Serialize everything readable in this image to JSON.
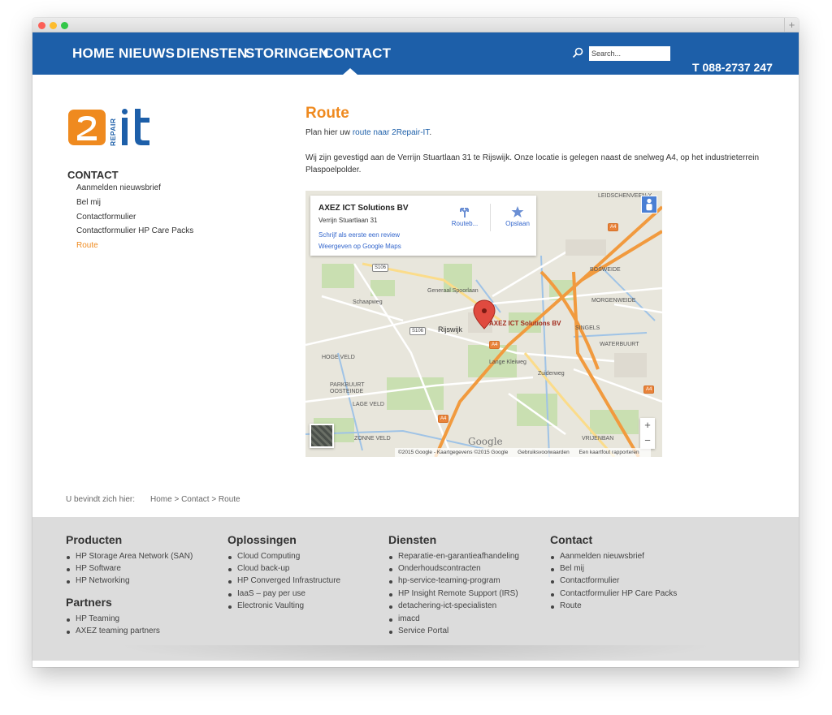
{
  "nav": {
    "items": [
      "HOME",
      "NIEUWS",
      "DIENSTEN",
      "STORINGEN",
      "CONTACT"
    ],
    "search_placeholder": "Search...",
    "phone": "T 088-2737 247"
  },
  "logo": {
    "text": "2REPAIR IT"
  },
  "sidebar": {
    "heading": "CONTACT",
    "items": [
      "Aanmelden nieuwsbrief",
      "Bel mij",
      "Contactformulier",
      "Contactformulier HP Care Packs",
      "Route"
    ],
    "active": "Route"
  },
  "content": {
    "title": "Route",
    "intro_prefix": "Plan hier uw ",
    "intro_link": "route naar 2Repair-IT",
    "intro_suffix": ".",
    "body": "Wij zijn gevestigd aan de Verrijn Stuartlaan 31 te Rijswijk. Onze locatie is gelegen naast de snelweg A4, op het industrieterrein Plaspoelpolder."
  },
  "map": {
    "place_name": "AXEZ ICT Solutions BV",
    "address": "Verrijn Stuartlaan 31",
    "link_review": "Schrijf als eerste een review",
    "link_maps": "Weergeven op Google Maps",
    "btn_route": "Routeb...",
    "btn_save": "Opslaan",
    "pin_label": "AXEZ ICT Solutions BV",
    "zoom_in": "+",
    "zoom_out": "−",
    "google": "Google",
    "attribution": [
      "©2015 Google - Kaartgegevens ©2015 Google",
      "Gebruiksvoorwaarden",
      "Een kaartfout rapporteren"
    ],
    "labels": [
      "Rijswijk",
      "HOGE VELD",
      "PARKBUURT OOSTEINDE",
      "LAGE VELD",
      "ZONNE VELD",
      "BOSWEIDE",
      "MORGENWEIDE",
      "SINGELS",
      "WATERBUURT",
      "VRIJENBAN",
      "Zuiderweg",
      "Generaal Spoorlaan",
      "Schaapweg",
      "Lange Kleiweg",
      "LEIDSCHENVEEN-Y"
    ],
    "shields": [
      "S106",
      "S106",
      "A4",
      "A4",
      "A4",
      "A4"
    ]
  },
  "breadcrumb": {
    "label": "U bevindt zich hier:",
    "path": "Home > Contact > Route"
  },
  "footer": {
    "columns": [
      {
        "title": "Producten",
        "items": [
          "HP Storage Area Network (SAN)",
          "HP Software",
          "HP Networking"
        ]
      },
      {
        "title": "Oplossingen",
        "items": [
          "Cloud Computing",
          "Cloud back-up",
          "HP Converged Infrastructure",
          "IaaS – pay per use",
          "Electronic Vaulting"
        ]
      },
      {
        "title": "Diensten",
        "items": [
          "Reparatie-en-garantieafhandeling",
          "Onderhoudscontracten",
          "hp-service-teaming-program",
          "HP Insight Remote Support (IRS)",
          "detachering-ict-specialisten",
          "imacd",
          "Service Portal"
        ]
      },
      {
        "title": "Contact",
        "items": [
          "Aanmelden nieuwsbrief",
          "Bel mij",
          "Contactformulier",
          "Contactformulier HP Care Packs",
          "Route"
        ]
      }
    ],
    "partners": {
      "title": "Partners",
      "items": [
        "HP Teaming",
        "AXEZ teaming partners"
      ]
    }
  },
  "colors": {
    "brand_blue": "#1d5fa9",
    "accent_orange": "#ef8a1f",
    "footer_bg": "#dcdcdc"
  }
}
